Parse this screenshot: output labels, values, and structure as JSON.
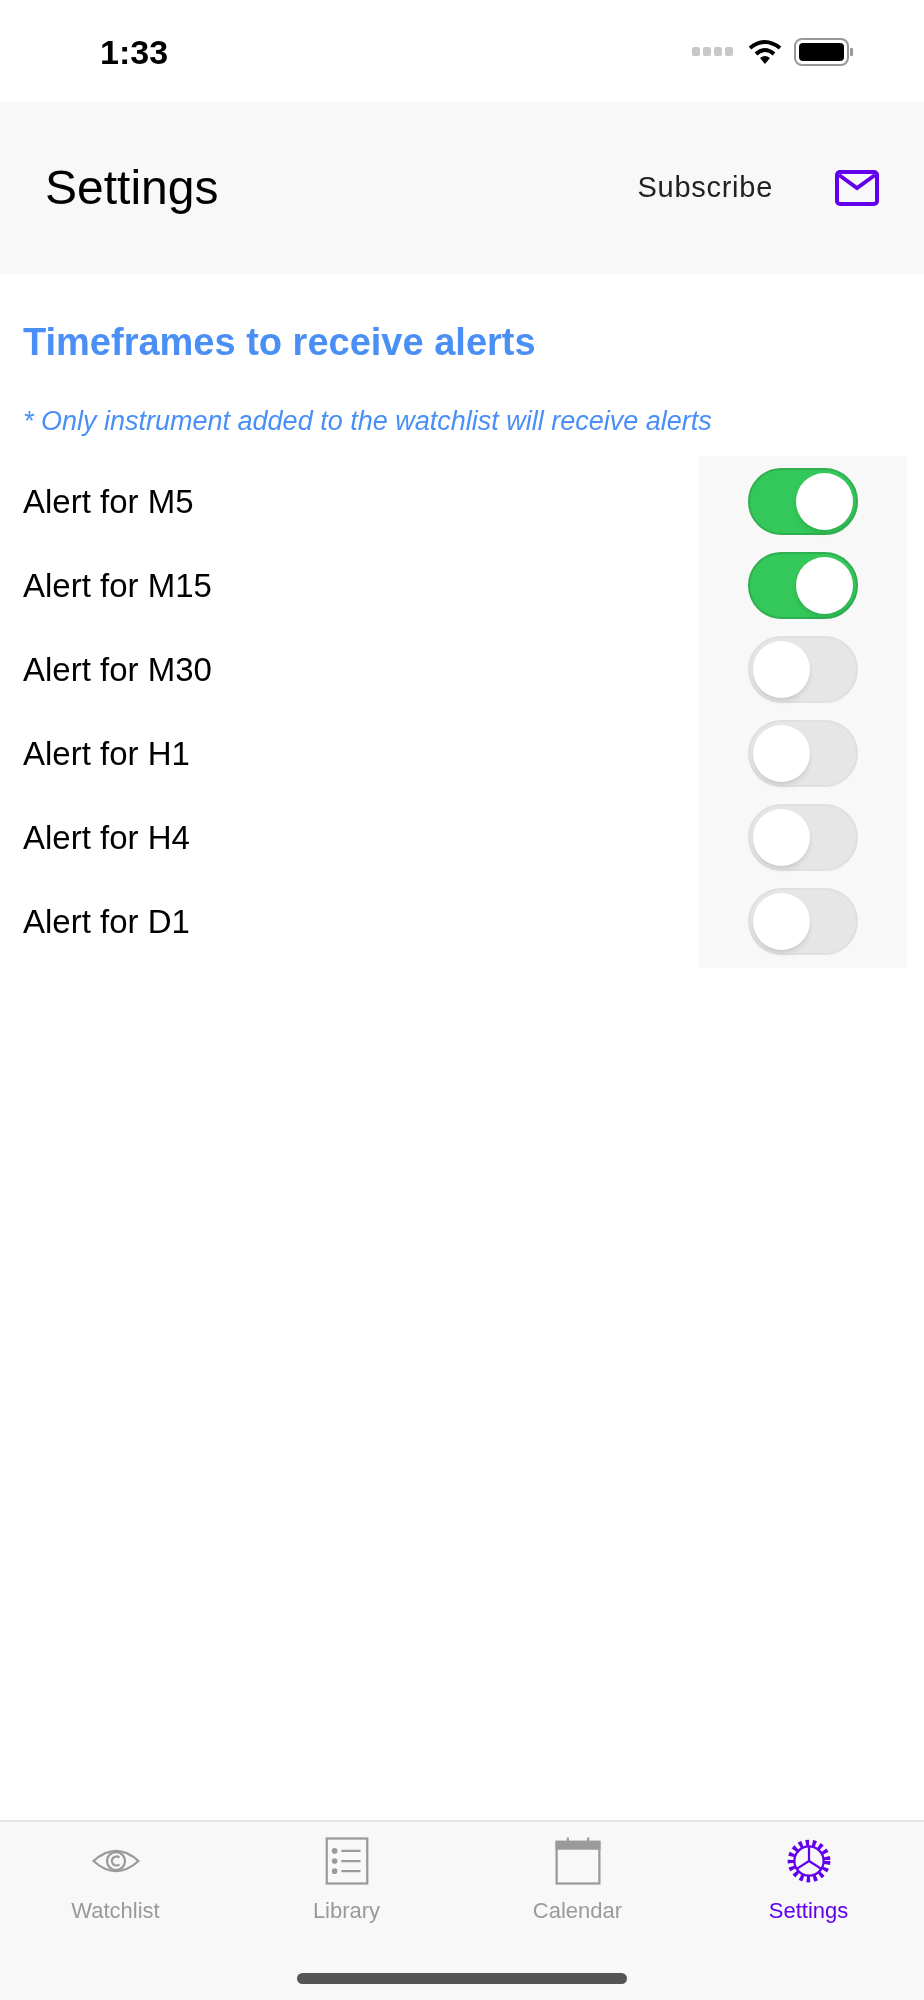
{
  "status_bar": {
    "time": "1:33"
  },
  "header": {
    "title": "Settings",
    "subscribe": "Subscribe"
  },
  "section": {
    "title": "Timeframes to receive alerts",
    "note": "* Only instrument added to the watchlist will receive alerts"
  },
  "alerts": [
    {
      "label": "Alert for M5",
      "on": true
    },
    {
      "label": "Alert for M15",
      "on": true
    },
    {
      "label": "Alert for M30",
      "on": false
    },
    {
      "label": "Alert for H1",
      "on": false
    },
    {
      "label": "Alert for H4",
      "on": false
    },
    {
      "label": "Alert for D1",
      "on": false
    }
  ],
  "tabs": [
    {
      "label": "Watchlist",
      "kind": "eye",
      "selected": false
    },
    {
      "label": "Library",
      "kind": "list",
      "selected": false
    },
    {
      "label": "Calendar",
      "kind": "calendar",
      "selected": false
    },
    {
      "label": "Settings",
      "kind": "gear",
      "selected": true
    }
  ]
}
